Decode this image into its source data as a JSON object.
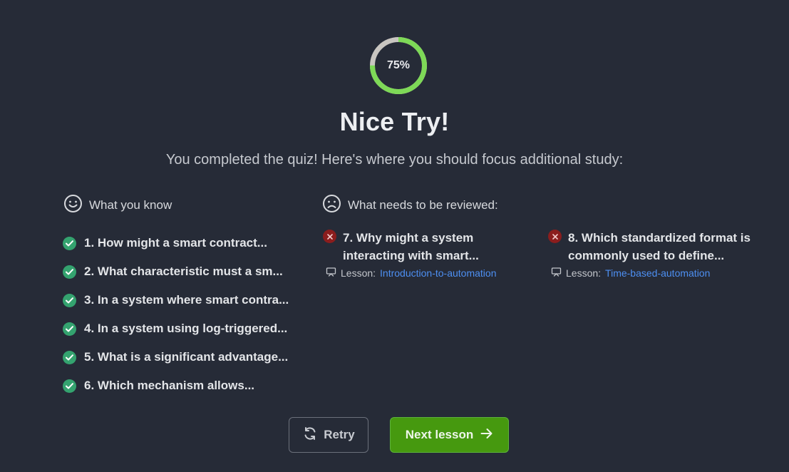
{
  "result": {
    "score_label": "75%",
    "score_fraction": 0.75,
    "headline": "Nice Try!",
    "subheadline": "You completed the quiz! Here's where you should focus additional study:"
  },
  "known": {
    "heading": "What you know",
    "icon": "smile-icon",
    "items": [
      "1. How might a smart contract...",
      "2. What characteristic must a sm...",
      "3. In a system where smart contra...",
      "4. In a system using log-triggered...",
      "5. What is a significant advantage...",
      "6. Which mechanism allows..."
    ]
  },
  "review": {
    "heading": "What needs to be reviewed:",
    "icon": "frown-icon",
    "items": [
      {
        "question": "7. Why might a system interacting with smart...",
        "lesson_prefix": "Lesson:",
        "lesson_name": "Introduction-to-automation"
      },
      {
        "question": "8. Which standardized format is commonly used to define...",
        "lesson_prefix": "Lesson:",
        "lesson_name": "Time-based-automation"
      }
    ]
  },
  "actions": {
    "retry_label": "Retry",
    "next_label": "Next lesson"
  },
  "colors": {
    "background": "#262b37",
    "progress": "#7ed957",
    "progress_track": "#c9c6c1",
    "correct": "#34a36f",
    "incorrect": "#8b1d1d",
    "link": "#4d8ff2",
    "primary_button": "#46990f"
  }
}
